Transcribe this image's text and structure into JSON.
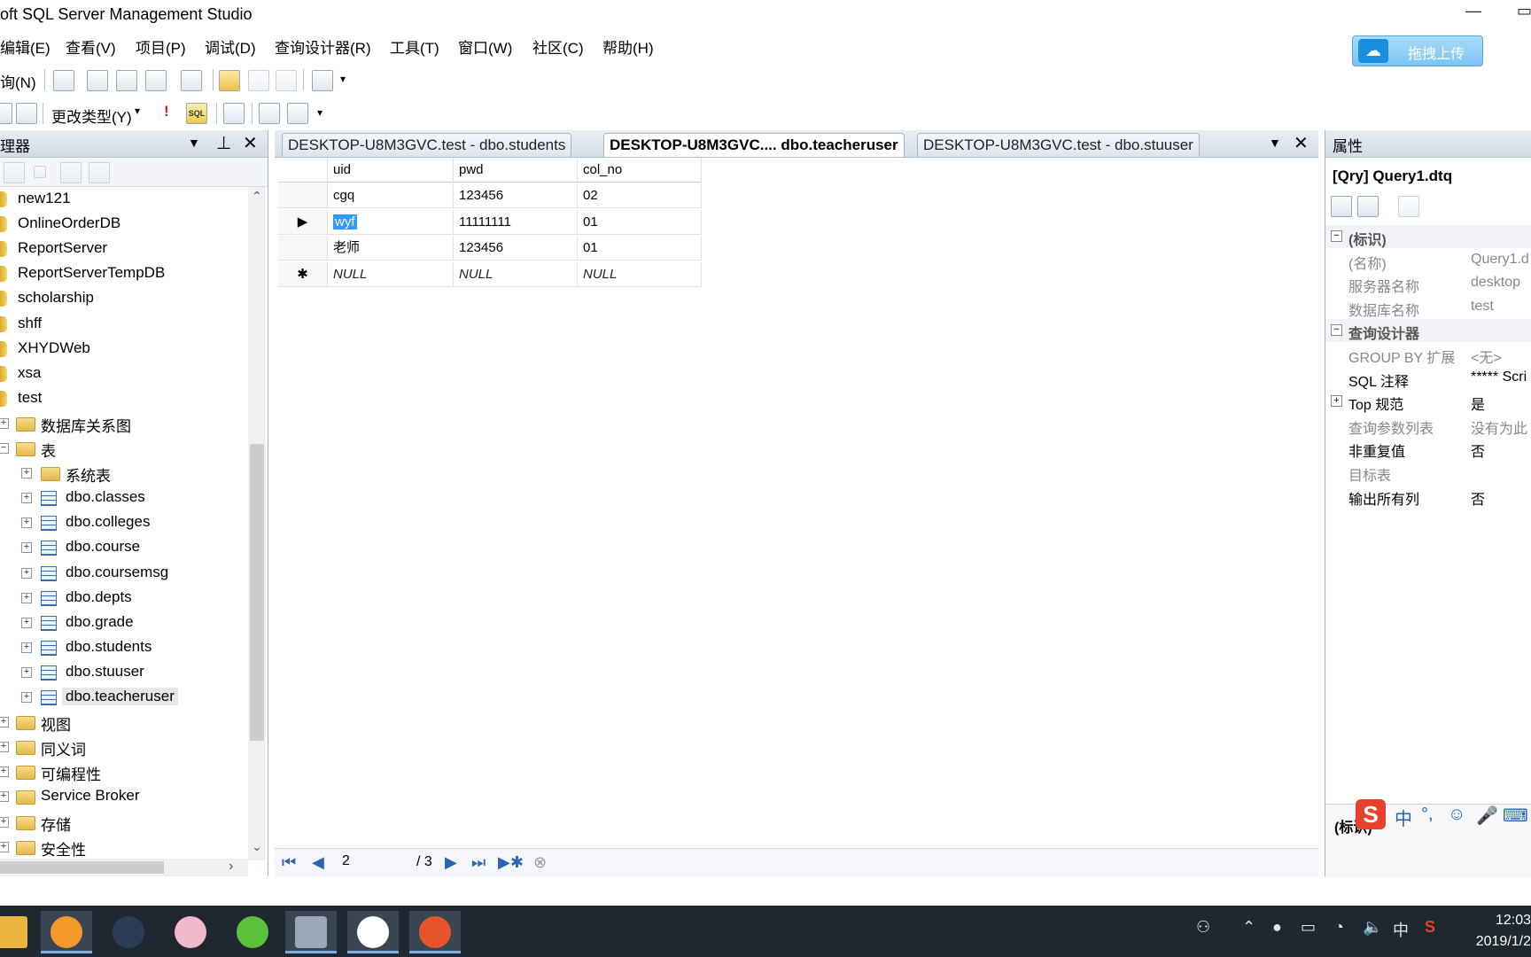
{
  "window": {
    "title": "oft SQL Server Management Studio",
    "minimize_glyph": "—",
    "restore_glyph": "▭"
  },
  "menu": [
    "编辑(E)",
    "查看(V)",
    "项目(P)",
    "调试(D)",
    "查询设计器(R)",
    "工具(T)",
    "窗口(W)",
    "社区(C)",
    "帮助(H)"
  ],
  "upload_button": {
    "label": "拖拽上传",
    "icon": "baidu-cloud-icon"
  },
  "toolbar1": {
    "new_query": "询(N)"
  },
  "toolbar2": {
    "change_type": "更改类型(Y)",
    "sql_label": "SQL"
  },
  "object_explorer": {
    "title": "理器",
    "items": [
      {
        "label": "new121",
        "kind": "db"
      },
      {
        "label": "OnlineOrderDB",
        "kind": "db"
      },
      {
        "label": "ReportServer",
        "kind": "db"
      },
      {
        "label": "ReportServerTempDB",
        "kind": "db"
      },
      {
        "label": "scholarship",
        "kind": "db"
      },
      {
        "label": "shff",
        "kind": "db"
      },
      {
        "label": "XHYDWeb",
        "kind": "db"
      },
      {
        "label": "xsa",
        "kind": "db"
      },
      {
        "label": "test",
        "kind": "db"
      },
      {
        "label": "数据库关系图",
        "kind": "folder",
        "expander": "+"
      },
      {
        "label": "表",
        "kind": "folder",
        "expander": "−"
      },
      {
        "label": "系统表",
        "kind": "folder",
        "expander": "+"
      },
      {
        "label": "dbo.classes",
        "kind": "table",
        "expander": "+"
      },
      {
        "label": "dbo.colleges",
        "kind": "table",
        "expander": "+"
      },
      {
        "label": "dbo.course",
        "kind": "table",
        "expander": "+"
      },
      {
        "label": "dbo.coursemsg",
        "kind": "table",
        "expander": "+"
      },
      {
        "label": "dbo.depts",
        "kind": "table",
        "expander": "+"
      },
      {
        "label": "dbo.grade",
        "kind": "table",
        "expander": "+"
      },
      {
        "label": "dbo.students",
        "kind": "table",
        "expander": "+"
      },
      {
        "label": "dbo.stuuser",
        "kind": "table",
        "expander": "+"
      },
      {
        "label": "dbo.teacheruser",
        "kind": "table",
        "expander": "+"
      },
      {
        "label": "视图",
        "kind": "folder",
        "expander": "+"
      },
      {
        "label": "同义词",
        "kind": "folder",
        "expander": "+"
      },
      {
        "label": "可编程性",
        "kind": "folder",
        "expander": "+"
      },
      {
        "label": "Service Broker",
        "kind": "folder",
        "expander": "+"
      },
      {
        "label": "存储",
        "kind": "folder",
        "expander": "+"
      },
      {
        "label": "安全性",
        "kind": "folder",
        "expander": "+"
      }
    ]
  },
  "tabs": [
    {
      "label": "DESKTOP-U8M3GVC.test - dbo.students",
      "active": false
    },
    {
      "label": "DESKTOP-U8M3GVC.... dbo.teacheruser",
      "active": true
    },
    {
      "label": "DESKTOP-U8M3GVC.test - dbo.stuuser",
      "active": false
    }
  ],
  "grid": {
    "columns": [
      "uid",
      "pwd",
      "col_no"
    ],
    "rows": [
      {
        "marker": "",
        "cells": [
          "cgq",
          "123456",
          "02"
        ]
      },
      {
        "marker": "▶",
        "cells": [
          "wyf",
          "11111111",
          "01"
        ],
        "selected_col": 0
      },
      {
        "marker": "",
        "cells": [
          "老师",
          "123456",
          "01"
        ]
      },
      {
        "marker": "✱",
        "cells": [
          "NULL",
          "NULL",
          "NULL"
        ],
        "null": true
      }
    ]
  },
  "navigator": {
    "current_page": "2",
    "total": "/ 3"
  },
  "properties": {
    "title": "属性",
    "object": "[Qry] Query1.dtq",
    "rows": [
      {
        "type": "cat",
        "key": "(标识)",
        "toggle": "−"
      },
      {
        "key": "(名称)",
        "value": "Query1.d",
        "gray": true
      },
      {
        "key": "服务器名称",
        "value": "desktop",
        "gray": true
      },
      {
        "key": "数据库名称",
        "value": "test",
        "gray": true
      },
      {
        "type": "cat",
        "key": "查询设计器",
        "toggle": "−"
      },
      {
        "key": "GROUP BY 扩展",
        "value": "<无>",
        "gray": true
      },
      {
        "key": "SQL 注释",
        "value": "***** Scri"
      },
      {
        "key": "Top 规范",
        "value": "是",
        "toggle": "+"
      },
      {
        "key": "查询参数列表",
        "value": "没有为此",
        "gray": true
      },
      {
        "key": "非重复值",
        "value": "否"
      },
      {
        "key": "目标表",
        "value": "",
        "gray": true
      },
      {
        "key": "输出所有列",
        "value": "否"
      }
    ],
    "description_title": "(标识)"
  },
  "ime": {
    "label": "中"
  },
  "clock": {
    "time": "12:03",
    "date": "2019/1/2"
  },
  "tray": {
    "lang": "中"
  }
}
